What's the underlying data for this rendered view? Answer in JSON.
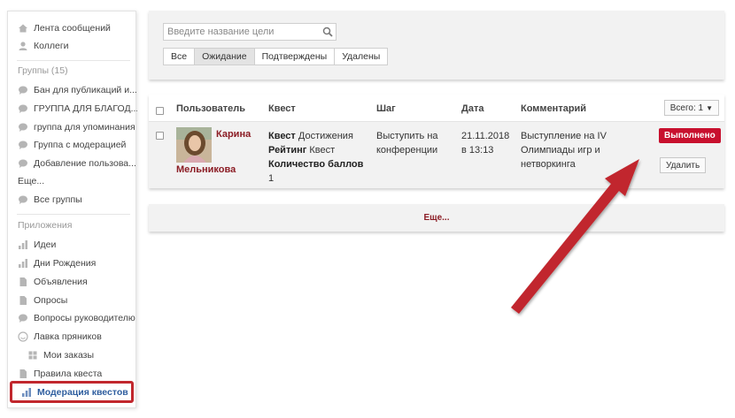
{
  "sidebar": {
    "feed": "Лента сообщений",
    "colleagues": "Коллеги",
    "groups_heading": "Группы (15)",
    "groups": [
      "Бан для публикаций и...",
      "ГРУППА ДЛЯ БЛАГОД...",
      "группа для упоминания",
      "Группа с модерацией",
      "Добавление пользова..."
    ],
    "more": "Еще...",
    "all_groups": "Все группы",
    "apps_heading": "Приложения",
    "apps": [
      "Идеи",
      "Дни Рождения",
      "Объявления",
      "Опросы",
      "Вопросы руководителю",
      "Лавка пряников"
    ],
    "my_orders": "Мои заказы",
    "quest_rules": "Правила квеста",
    "quest_moderation": "Модерация квестов"
  },
  "filter": {
    "search_placeholder": "Введите название цели",
    "tabs": [
      "Все",
      "Ожидание",
      "Подтверждены",
      "Удалены"
    ],
    "active_tab": "Ожидание"
  },
  "table": {
    "headers": {
      "user": "Пользователь",
      "quest": "Квест",
      "step": "Шаг",
      "date": "Дата",
      "comment": "Комментарий"
    },
    "total_label": "Всего: 1",
    "rows": [
      {
        "user_first": "Карина",
        "user_last": "Мельникова",
        "quest_w1": "Квест",
        "quest_w2": "Достижения",
        "quest_w3": "Рейтинг",
        "quest_w4": "Квест",
        "quest_w5": "Количество баллов",
        "quest_w6": "1",
        "step_l1": "Выступить на",
        "step_l2": "конференции",
        "date_l1": "21.11.2018",
        "date_l2": "в 13:13",
        "comment_l1": "Выступление на IV",
        "comment_l2": "Олимпиады игр и",
        "comment_l3": "нетворкинга",
        "done_label": "Выполнено",
        "delete_label": "Удалить"
      }
    ]
  },
  "more_label": "Еще...",
  "colors": {
    "accent_red": "#c8102e",
    "user_name": "#8b1c24",
    "active_link": "#2f5d9e",
    "annotation": "#c1272d"
  }
}
